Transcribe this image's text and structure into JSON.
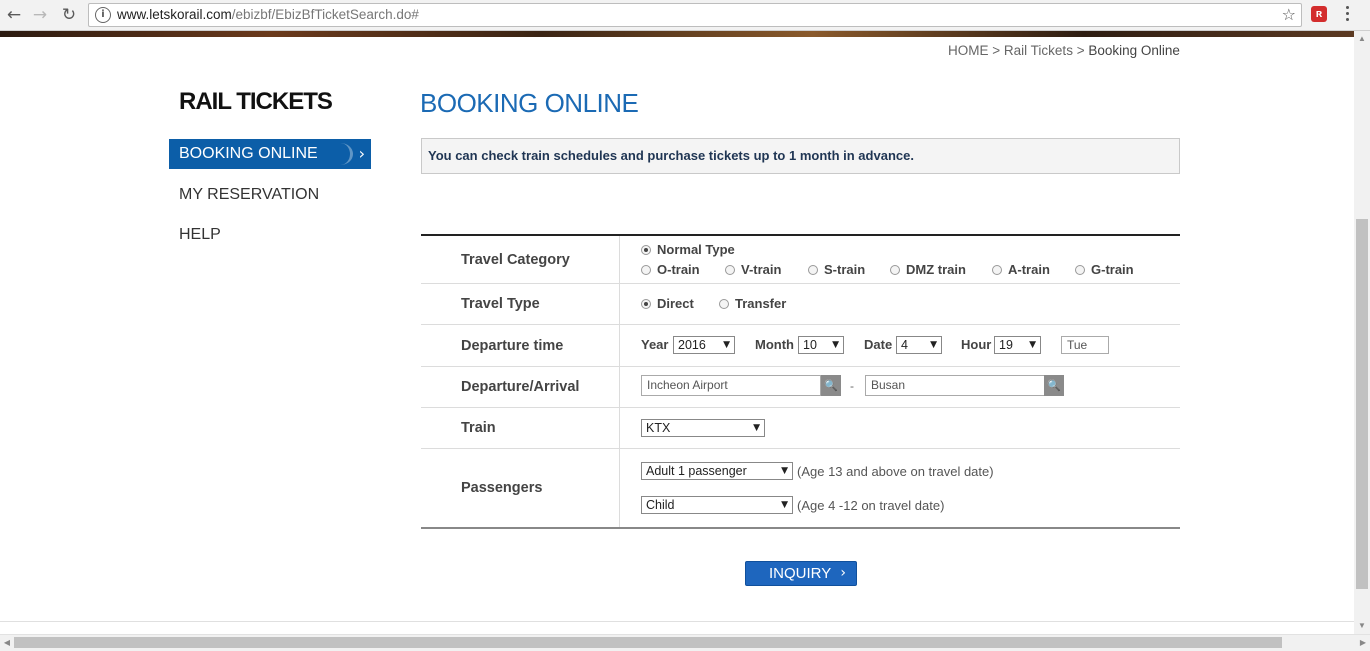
{
  "browser": {
    "url_host": "www.letskorail.com",
    "url_path": "/ebizbf/EbizBfTicketSearch.do#"
  },
  "breadcrumb": {
    "home": "HOME",
    "sep": ">",
    "section": "Rail Tickets",
    "current": "Booking Online"
  },
  "sidebar": {
    "title": "RAIL TICKETS",
    "items": [
      {
        "label": "BOOKING ONLINE",
        "active": true
      },
      {
        "label": "MY RESERVATION",
        "active": false
      },
      {
        "label": "HELP",
        "active": false
      }
    ]
  },
  "main": {
    "title": "BOOKING ONLINE",
    "notice": "You can check train schedules and purchase tickets up to 1 month in advance."
  },
  "form": {
    "travel_category": {
      "label": "Travel Category",
      "options": [
        "Normal Type",
        "O-train",
        "V-train",
        "S-train",
        "DMZ train",
        "A-train",
        "G-train"
      ],
      "selected": "Normal Type"
    },
    "travel_type": {
      "label": "Travel Type",
      "options": [
        "Direct",
        "Transfer"
      ],
      "selected": "Direct"
    },
    "departure_time": {
      "label": "Departure time",
      "year_label": "Year",
      "year": "2016",
      "month_label": "Month",
      "month": "10",
      "date_label": "Date",
      "date": "4",
      "hour_label": "Hour",
      "hour": "19",
      "weekday": "Tue"
    },
    "departure_arrival": {
      "label": "Departure/Arrival",
      "from": "Incheon Airport",
      "dash": "-",
      "to": "Busan"
    },
    "train": {
      "label": "Train",
      "value": "KTX"
    },
    "passengers": {
      "label": "Passengers",
      "adult": "Adult 1 passenger",
      "adult_note": "(Age 13 and above on travel date)",
      "child": "Child",
      "child_note": "(Age 4 -12 on travel date)"
    }
  },
  "inquiry_label": "INQUIRY",
  "colors": {
    "accent": "#0c5ea8",
    "title_blue": "#1b6ab4",
    "button_blue": "#1e66be"
  }
}
